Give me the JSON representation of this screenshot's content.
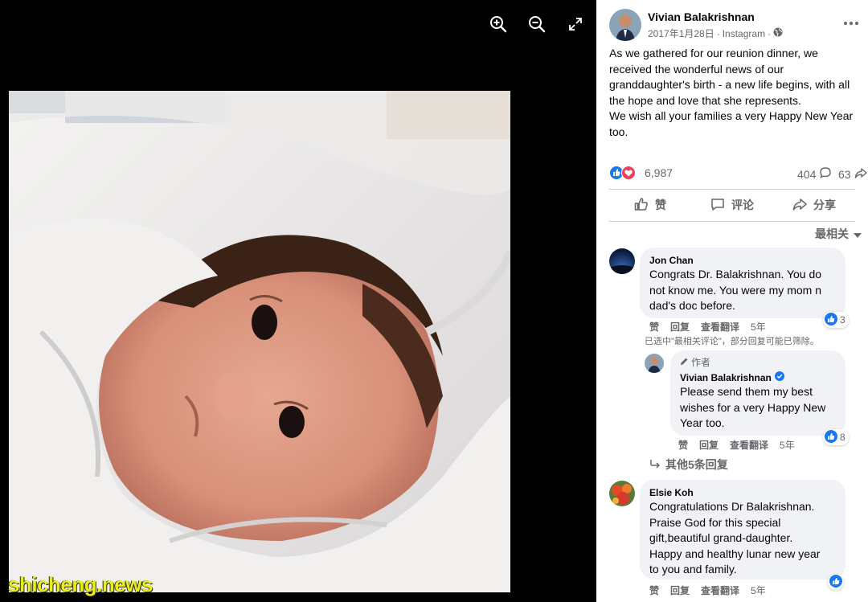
{
  "viewer": {
    "tools": [
      "zoom-in",
      "zoom-out",
      "fullscreen"
    ],
    "watermark": "shicheng.news"
  },
  "post": {
    "author": "Vivian Balakrishnan",
    "date": "2017年1月28日",
    "source": "Instagram",
    "separator": "·",
    "text_lines": [
      "As we gathered for our reunion dinner, we",
      "received the wonderful news of our",
      "granddaughter's birth - a new life begins, with all",
      "the hope and love that she represents.",
      "We wish all your families a very Happy New Year",
      "too."
    ],
    "reactions_count": "6,987",
    "comments_count": "404",
    "shares_count": "63"
  },
  "actions": {
    "like": "赞",
    "comment": "评论",
    "share": "分享"
  },
  "sort_label": "最相关",
  "comments": [
    {
      "name": "Jon Chan",
      "lines": [
        "Congrats Dr. Balakrishnan. You do",
        "not know me. You were my mom n",
        "dad's doc before."
      ],
      "like": "赞",
      "reply": "回复",
      "translate": "查看翻译",
      "time": "5年",
      "reactions": "3"
    },
    {
      "author_tag": "作者",
      "name": "Vivian Balakrishnan",
      "lines": [
        "Please send them my best",
        "wishes for a very Happy New",
        "Year too."
      ],
      "like": "赞",
      "reply": "回复",
      "translate": "查看翻译",
      "time": "5年",
      "reactions": "8"
    },
    {
      "name": "Elsie Koh",
      "lines": [
        "Congratulations Dr Balakrishnan.",
        "Praise God for this special",
        "gift,beautiful grand-daughter.",
        "Happy and healthy lunar new year",
        "to you and family."
      ],
      "like": "赞",
      "reply": "回复",
      "translate": "查看翻译",
      "time": "5年"
    }
  ],
  "filter_note": "已选中\"最相关评论\"，部分回复可能已筛除。",
  "more_replies": "其他5条回复",
  "colors": {
    "like_blue": "#1877f2",
    "love_red": "#f33e58",
    "verified_blue": "#1877f2",
    "watermark_yellow": "#e8ef1a"
  }
}
